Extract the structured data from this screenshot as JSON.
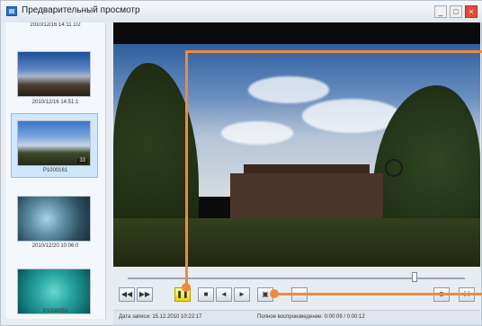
{
  "window": {
    "title": "Предварительный просмотр",
    "minimize_label": "_",
    "maximize_label": "□",
    "close_label": "×"
  },
  "sidebar": {
    "scroll_up_glyph": "▲",
    "items": [
      {
        "caption_top": "2010/12/16 14:11 1/2",
        "caption": ""
      },
      {
        "caption": "2010/12/16 14:51:1"
      },
      {
        "caption": "P1000161",
        "badge": "33"
      },
      {
        "caption": "2010/12/20 10:06:0"
      },
      {
        "caption": "P1000053"
      }
    ]
  },
  "player": {
    "position": 0.85
  },
  "controls": {
    "buttons": [
      {
        "name": "previous-file-button",
        "glyph": "◀◀"
      },
      {
        "name": "next-file-button",
        "glyph": "▶▶"
      },
      {
        "name": "play-pause-button",
        "glyph": "❚❚"
      },
      {
        "name": "stop-button",
        "glyph": "■"
      },
      {
        "name": "frame-back-button",
        "glyph": "◄"
      },
      {
        "name": "frame-forward-button",
        "glyph": "►"
      },
      {
        "name": "snapshot-button",
        "glyph": "▣"
      },
      {
        "name": "slow-motion-button",
        "glyph": "⋯"
      },
      {
        "name": "zoom-button",
        "glyph": "⊕"
      },
      {
        "name": "fullscreen-button",
        "glyph": "⛶"
      }
    ]
  },
  "status": {
    "recording_date": "Дата записи: 15.12.2010 10:22:17",
    "playback_total": "Полное воспроизведение: 0:00:09 / 0:00:12"
  },
  "colors": {
    "accent": "#f08a3c",
    "play_button": "#f2d200"
  }
}
